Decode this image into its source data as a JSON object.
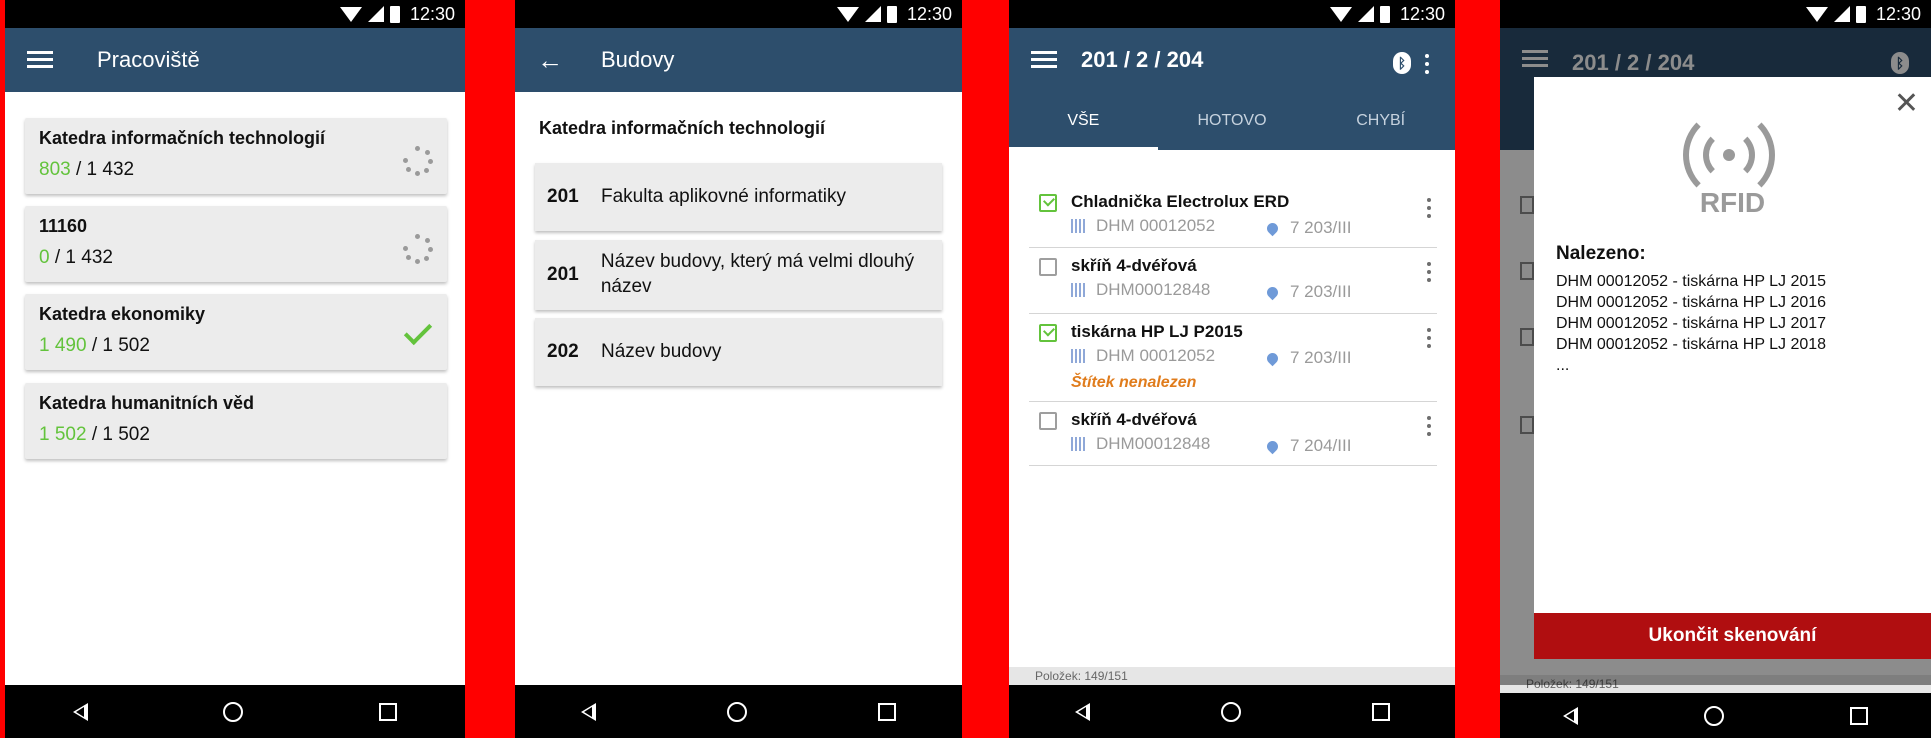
{
  "status": {
    "time": "12:30"
  },
  "screen1": {
    "title": "Pracoviště",
    "cards": [
      {
        "name": "Katedra informačních technologií",
        "done": "803",
        "total": "/ 1 432",
        "state": "loading"
      },
      {
        "name": "11160",
        "done": "0",
        "total": "/ 1 432",
        "state": "loading"
      },
      {
        "name": "Katedra ekonomiky",
        "done": "1 490",
        "total": "/ 1 502",
        "state": "complete"
      },
      {
        "name": "Katedra humanitních věd",
        "done": "1 502",
        "total": "/ 1 502",
        "state": "none"
      }
    ]
  },
  "screen2": {
    "title": "Budovy",
    "heading": "Katedra informačních technologií",
    "buildings": [
      {
        "number": "201",
        "name": "Fakulta aplikovné informatiky"
      },
      {
        "number": "201",
        "name": "Název budovy, který má velmi dlouhý název"
      },
      {
        "number": "202",
        "name": "Název budovy"
      }
    ]
  },
  "screen3": {
    "title": "201 / 2 / 204",
    "tabs": [
      "VŠE",
      "HOTOVO",
      "CHYBÍ"
    ],
    "active_tab": 0,
    "items": [
      {
        "name": "Chladnička Electrolux ERD",
        "code": "DHM 00012052",
        "location": "7 203/III",
        "checked": true,
        "warning": ""
      },
      {
        "name": "skříň 4-dvéřová",
        "code": "DHM00012848",
        "location": "7 203/III",
        "checked": false,
        "warning": ""
      },
      {
        "name": "tiskárna HP LJ P2015",
        "code": "DHM 00012052",
        "location": "7 203/III",
        "checked": true,
        "warning": "Štítek nenalezen"
      },
      {
        "name": "skříň 4-dvéřová",
        "code": "DHM00012848",
        "location": "7 204/III",
        "checked": false,
        "warning": ""
      }
    ],
    "footer": "Položek: 149/151"
  },
  "screen4": {
    "title": "201 / 2 / 204",
    "rfid_label": "RFID",
    "found_title": "Nalezeno:",
    "found": [
      "DHM 00012052 - tiskárna HP LJ 2015",
      "DHM 00012052 - tiskárna HP LJ 2016",
      "DHM 00012052 - tiskárna HP LJ 2017",
      "DHM 00012052 - tiskárna HP LJ 2018",
      "..."
    ],
    "close_symbol": "✕",
    "stop_button": "Ukončit skenování",
    "footer": "Položek: 149/151"
  },
  "colors": {
    "appbar": "#2d4e6c",
    "accent_green": "#63c33c",
    "warning": "#e07c1c",
    "danger": "#b00e10",
    "background": "#ff0000"
  }
}
